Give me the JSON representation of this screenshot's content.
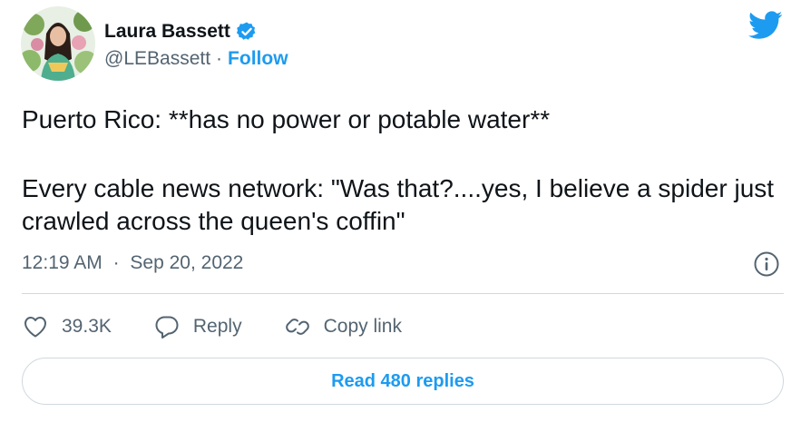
{
  "author": {
    "name": "Laura Bassett",
    "handle": "@LEBassett",
    "separator": "·",
    "follow_label": "Follow"
  },
  "tweet": {
    "line1": "Puerto Rico: **has no power or potable water**",
    "line2": "Every cable news network: \"Was that?....yes, I believe a spider just crawled across the queen's coffin\""
  },
  "meta": {
    "time": "12:19 AM",
    "separator": "·",
    "date": "Sep 20, 2022"
  },
  "actions": {
    "likes": "39.3K",
    "reply_label": "Reply",
    "copy_label": "Copy link"
  },
  "read_replies_label": "Read 480 replies",
  "colors": {
    "accent": "#1d9bf0",
    "text": "#0f1419",
    "muted": "#536471",
    "border": "#cfd9de"
  },
  "icons": {
    "brand": "twitter-bird-icon",
    "verified": "verified-badge-icon",
    "info": "info-icon",
    "like": "heart-icon",
    "reply": "reply-bubble-icon",
    "copy": "link-icon"
  }
}
